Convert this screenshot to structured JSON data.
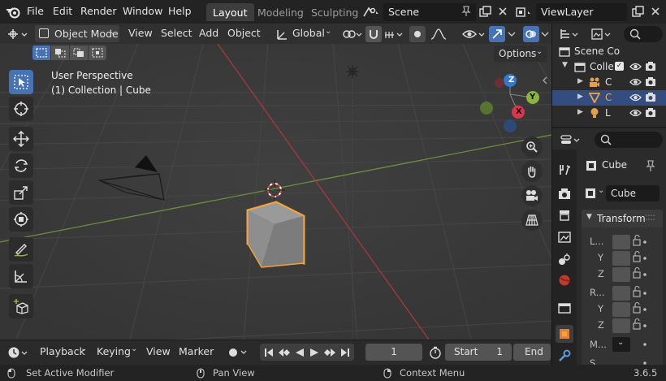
{
  "menu": {
    "file": "File",
    "edit": "Edit",
    "render": "Render",
    "window": "Window",
    "help": "Help"
  },
  "workspaces": [
    "Layout",
    "Modeling",
    "Sculpting"
  ],
  "scene": {
    "name": "Scene"
  },
  "view_layer": {
    "name": "ViewLayer"
  },
  "viewport_header": {
    "mode": "Object Mode",
    "view": "View",
    "select": "Select",
    "add": "Add",
    "object": "Object",
    "orientation": "Global"
  },
  "viewport": {
    "options": "Options",
    "perspective": "User Perspective",
    "collection_info": "(1) Collection | Cube",
    "gizmo": {
      "z": "Z",
      "y": "Y",
      "x": "X"
    }
  },
  "outliner": {
    "scene_collection": "Scene Co",
    "collection": "Colle",
    "items": [
      "C",
      "C",
      "L"
    ]
  },
  "properties": {
    "object_name": "Cube",
    "data_name": "Cube",
    "transform_label": "Transform",
    "location_label": "L...",
    "y_label": "Y",
    "z_label": "Z",
    "rotation_label": "R...",
    "mode_label": "M...",
    "scale_label": "S..."
  },
  "timeline": {
    "playback": "Playback",
    "keying": "Keying",
    "view": "View",
    "marker": "Marker",
    "current_frame": "1",
    "start_label": "Start",
    "start_value": "1",
    "end_label": "End"
  },
  "status": {
    "left": "Set Active Modifier",
    "middle": "Pan View",
    "right": "Context Menu",
    "version": "3.6.5"
  },
  "colors": {
    "accent": "#4772b3",
    "selection": "#f5a33a",
    "axis_x": "#d6394d",
    "axis_y": "#8ab43c",
    "axis_z": "#2e7bd6"
  }
}
